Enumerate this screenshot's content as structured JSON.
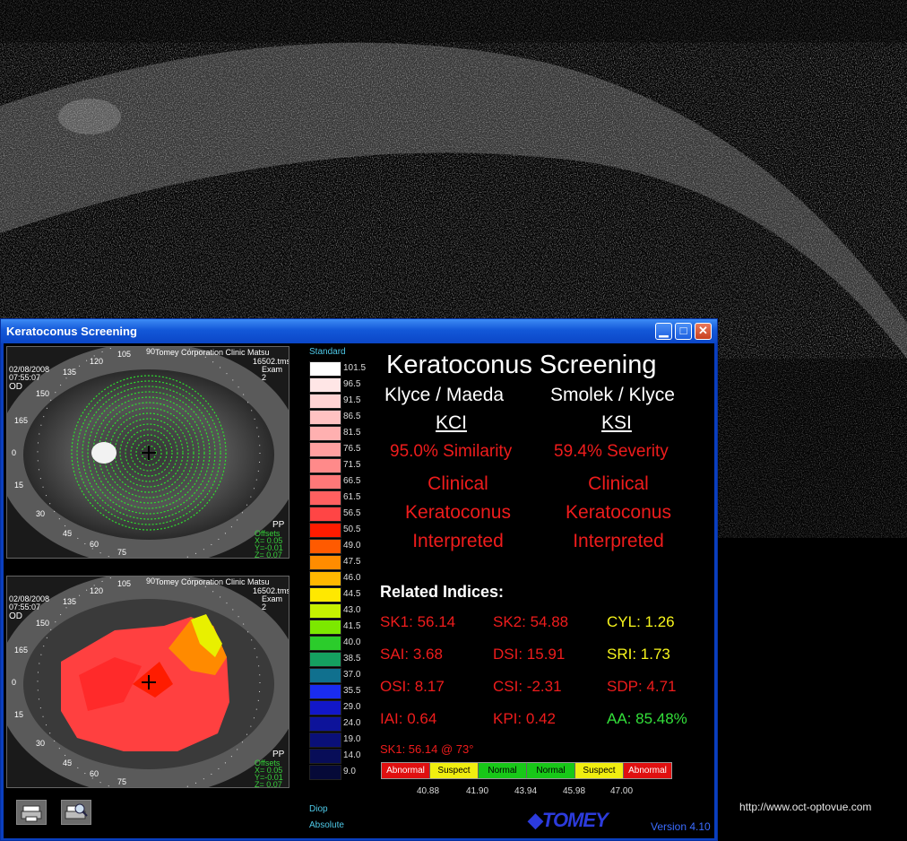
{
  "window": {
    "title": "Keratoconus Screening",
    "min_symbol": "▁",
    "max_symbol": "□",
    "close_symbol": "✕"
  },
  "maps": [
    {
      "header_line": "Tomey Corporation Clinic Matsu",
      "file": "16502.tms",
      "exam": "Exam 2",
      "date": "02/08/2008",
      "time": "07:55:07",
      "eye": "OD",
      "pp": "PP",
      "offsets_label": "Offsets",
      "offset_x": "X= 0.05",
      "offset_y": "Y=-0.01",
      "offset_z": "Z= 0.07",
      "axis_labels": [
        "90",
        "105",
        "120",
        "135",
        "150",
        "165",
        "0",
        "15",
        "30",
        "45",
        "60",
        "75"
      ]
    },
    {
      "header_line": "Tomey Corporation Clinic Matsu",
      "file": "16502.tms",
      "exam": "Exam 2",
      "date": "02/08/2008",
      "time": "07:55:07",
      "eye": "OD",
      "pp": "PP",
      "offsets_label": "Offsets",
      "offset_x": "X= 0.05",
      "offset_y": "Y=-0.01",
      "offset_z": "Z= 0.07",
      "axis_labels": [
        "90",
        "105",
        "120",
        "135",
        "150",
        "165",
        "0",
        "15",
        "30",
        "45",
        "60",
        "75"
      ]
    }
  ],
  "scale": {
    "header": "Standard",
    "footer_unit": "Diop",
    "footer_mode": "Absolute",
    "values": [
      "101.5",
      "96.5",
      "91.5",
      "86.5",
      "81.5",
      "76.5",
      "71.5",
      "66.5",
      "61.5",
      "56.5",
      "50.5",
      "49.0",
      "47.5",
      "46.0",
      "44.5",
      "43.0",
      "41.5",
      "40.0",
      "38.5",
      "37.0",
      "35.5",
      "29.0",
      "24.0",
      "19.0",
      "14.0",
      "9.0"
    ],
    "colors": [
      "#ffffff",
      "#ffe6e6",
      "#ffd3d3",
      "#ffc2c2",
      "#ffb0b0",
      "#ff9f9f",
      "#ff8a8a",
      "#ff7878",
      "#ff6060",
      "#ff4545",
      "#ff1c00",
      "#ff5a00",
      "#ff8c00",
      "#ffb800",
      "#ffe800",
      "#c6f000",
      "#7ce800",
      "#2bcc2b",
      "#15a060",
      "#10708e",
      "#1a2cf0",
      "#1217c8",
      "#0d139a",
      "#0a1078",
      "#080d58",
      "#060a38"
    ]
  },
  "screening": {
    "title": "Keratoconus Screening",
    "left_method": "Klyce / Maeda",
    "left_index": "KCI",
    "left_result": "95.0% Similarity",
    "left_interp": [
      "Clinical",
      "Keratoconus",
      "Interpreted"
    ],
    "right_method": "Smolek / Klyce",
    "right_index": "KSI",
    "right_result": "59.4% Severity",
    "right_interp": [
      "Clinical",
      "Keratoconus",
      "Interpreted"
    ]
  },
  "related": {
    "header": "Related Indices:",
    "items": [
      {
        "text": "SK1: 56.14",
        "color": "red"
      },
      {
        "text": "SK2: 54.88",
        "color": "red"
      },
      {
        "text": "CYL:  1.26",
        "color": "yel"
      },
      {
        "text": "SAI: 3.68",
        "color": "red"
      },
      {
        "text": "DSI: 15.91",
        "color": "red"
      },
      {
        "text": "SRI: 1.73",
        "color": "yel"
      },
      {
        "text": "OSI: 8.17",
        "color": "red"
      },
      {
        "text": "CSI: -2.31",
        "color": "red"
      },
      {
        "text": "SDP: 4.71",
        "color": "red"
      },
      {
        "text": "IAI: 0.64",
        "color": "red"
      },
      {
        "text": "KPI: 0.42",
        "color": "red"
      },
      {
        "text": "AA: 85.48%",
        "color": "grn"
      }
    ],
    "sk1_axis": "SK1: 56.14 @ 73°"
  },
  "range_bar": {
    "segments": [
      {
        "label": "Abnormal",
        "bg": "#e01010",
        "fg": "#ffffff"
      },
      {
        "label": "Suspect",
        "bg": "#f0ee10",
        "fg": "#000000"
      },
      {
        "label": "Normal",
        "bg": "#18c818",
        "fg": "#000000"
      },
      {
        "label": "Normal",
        "bg": "#18c818",
        "fg": "#000000"
      },
      {
        "label": "Suspect",
        "bg": "#f0ee10",
        "fg": "#000000"
      },
      {
        "label": "Abnormal",
        "bg": "#e01010",
        "fg": "#ffffff"
      }
    ],
    "ticks": [
      "40.88",
      "41.90",
      "43.94",
      "45.98",
      "47.00"
    ]
  },
  "footer": {
    "brand": "TOMEY",
    "version": "Version 4.10"
  },
  "watermark_url": "http://www.oct-optovue.com"
}
